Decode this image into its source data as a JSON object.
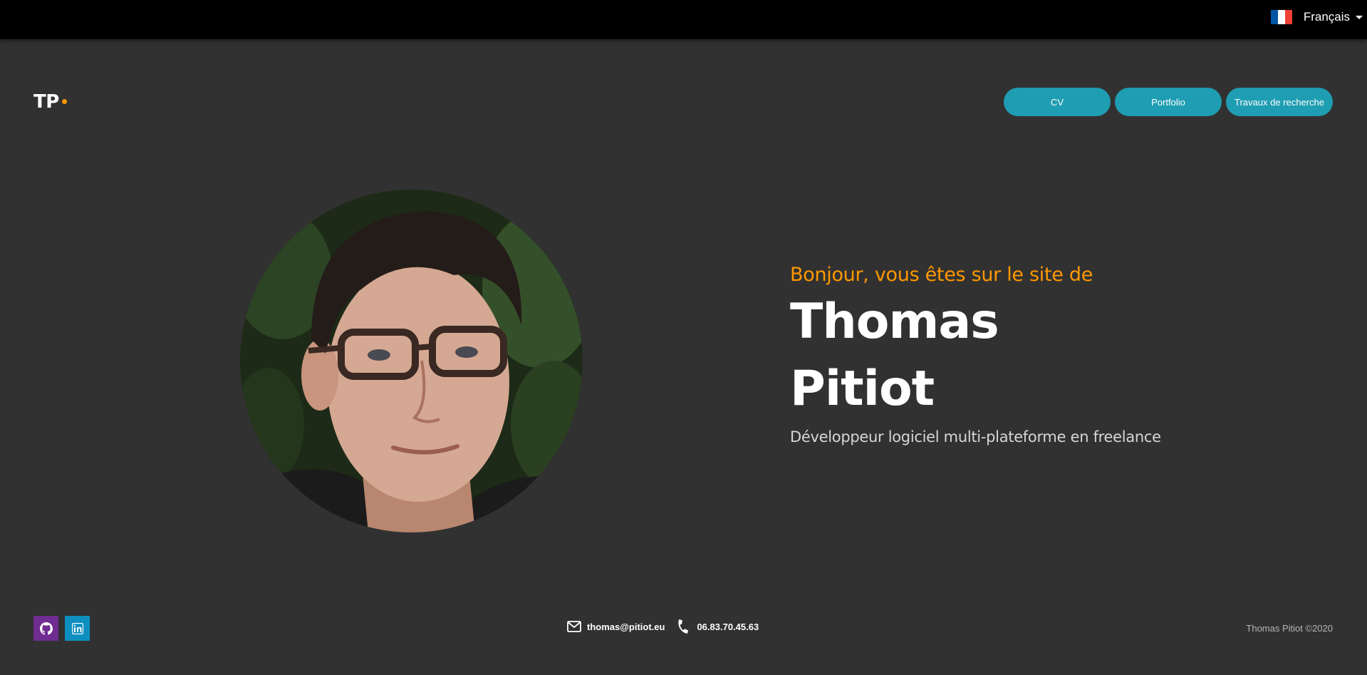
{
  "language": {
    "label": "Français",
    "flag_colors": [
      "#0055a4",
      "#ffffff",
      "#ef4135"
    ]
  },
  "logo": {
    "text": "TP",
    "dot_color": "#ff9800"
  },
  "nav": {
    "cv": "CV",
    "portfolio": "Portfolio",
    "research": "Travaux de recherche",
    "button_color": "#1f9db2"
  },
  "intro": {
    "greeting": "Bonjour, vous êtes sur le site de",
    "first_name": "Thomas",
    "last_name": "Pitiot",
    "subtitle": "Développeur logiciel multi-plateforme en freelance",
    "accent_color": "#ff9800"
  },
  "footer": {
    "github_icon": "github-icon",
    "github_color": "#6f2c91",
    "linkedin_icon": "linkedin-icon",
    "linkedin_color": "#0e8fc0",
    "email": "thomas@pitiot.eu",
    "phone": "06.83.70.45.63",
    "copyright": "Thomas Pitiot ©2020"
  }
}
